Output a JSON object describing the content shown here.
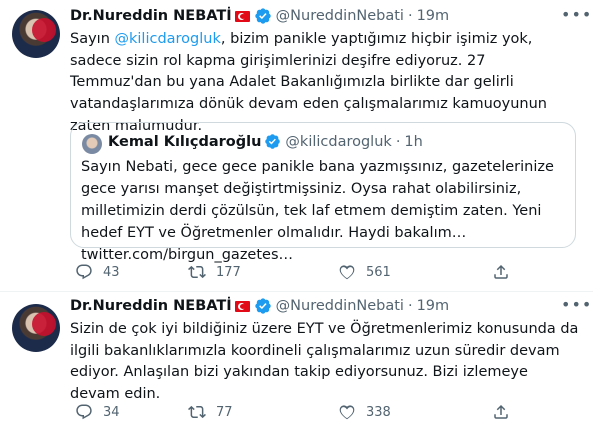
{
  "tweets": [
    {
      "author": {
        "name": "Dr.Nureddin NEBATİ",
        "handle": "@NureddinNebati",
        "time": "19m"
      },
      "body_prefix": "Sayın ",
      "mention": "@kilicdarogluk",
      "body_rest": ", bizim panikle yaptığımız hiçbir işimiz yok, sadece sizin rol kapma girişimlerinizi deşifre ediyoruz. 27 Temmuz'dan bu yana Adalet Bakanlığımızla birlikte dar gelirli vatandaşlarımıza dönük devam eden çalışmalarımız kamuoyunun zaten malumudur.",
      "quote": {
        "author_name": "Kemal Kılıçdaroğlu",
        "handle": "@kilicdarogluk",
        "time": "1h",
        "text": "Sayın Nebati, gece gece panikle bana yazmışsınız, gazetelerinize gece yarısı manşet değiştirtmişsiniz. Oysa rahat olabilirsiniz, milletimizin derdi çözülsün, tek laf etmem demiştim zaten. Yeni hedef EYT ve Öğretmenler olmalıdır. Haydi bakalım… twitter.com/birgun_gazetes…"
      },
      "counts": {
        "replies": "43",
        "retweets": "177",
        "likes": "561"
      }
    },
    {
      "author": {
        "name": "Dr.Nureddin NEBATİ",
        "handle": "@NureddinNebati",
        "time": "19m"
      },
      "body": "Sizin de çok iyi bildiğiniz üzere EYT ve Öğretmenlerimiz konusunda da ilgili bakanlıklarımızla koordineli çalışmalarımız uzun süredir devam ediyor. Anlaşılan bizi yakından takip ediyorsunuz. Bizi izlemeye devam edin.",
      "counts": {
        "replies": "34",
        "retweets": "77",
        "likes": "338"
      }
    }
  ],
  "icons": {
    "verified": "verified-badge-icon",
    "flag": "turkey-flag-icon",
    "more": "more-icon",
    "reply": "reply-icon",
    "retweet": "retweet-icon",
    "like": "heart-icon",
    "share": "share-icon"
  },
  "colors": {
    "accent": "#1d9bf0",
    "secondary_text": "#536471",
    "flag_red": "#e30a17",
    "border": "#cfd9de"
  }
}
